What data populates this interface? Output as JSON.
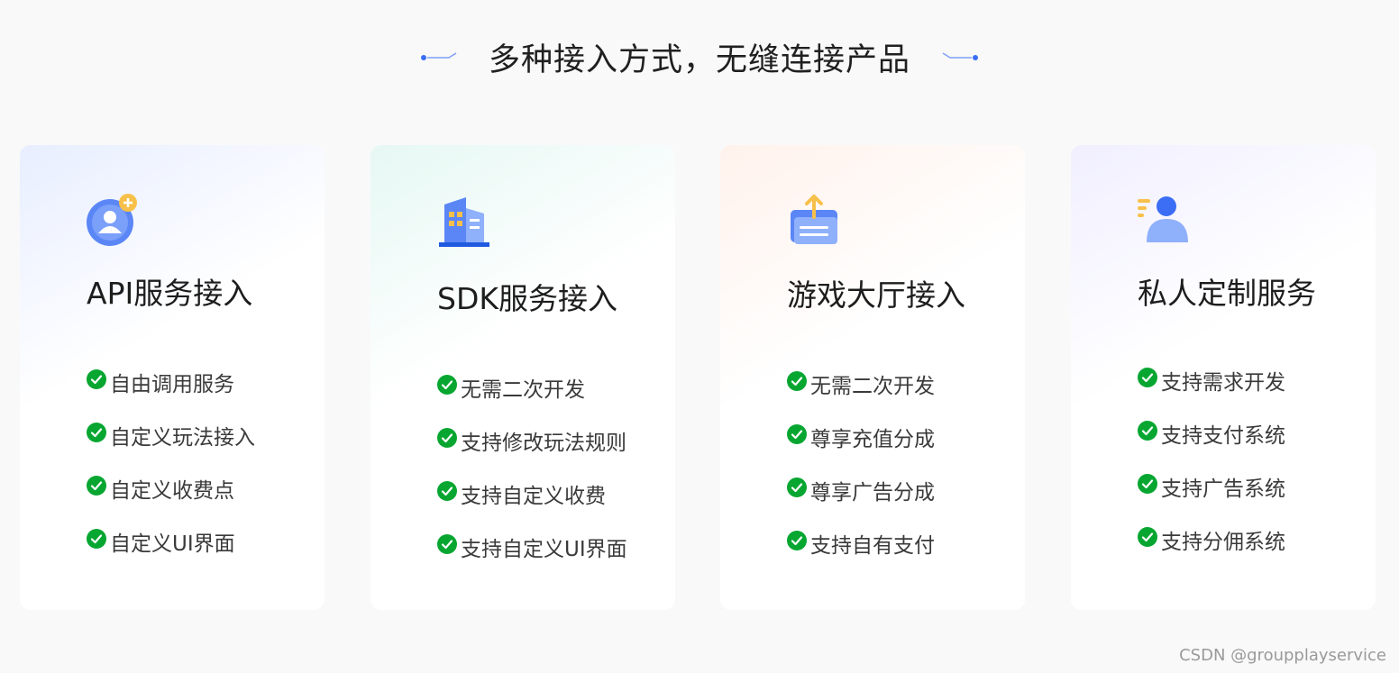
{
  "heading": {
    "title": "多种接入方式，无缝连接产品"
  },
  "colors": {
    "accent": "#3b6ef5",
    "check": "#07a631",
    "gold": "#f7c04a"
  },
  "cards": [
    {
      "icon": "user-add-icon",
      "title": "API服务接入",
      "features": [
        "自由调用服务",
        "自定义玩法接入",
        "自定义收费点",
        "自定义UI界面"
      ]
    },
    {
      "icon": "building-icon",
      "title": "SDK服务接入",
      "features": [
        "无需二次开发",
        "支持修改玩法规则",
        "支持自定义收费",
        "支持自定义UI界面"
      ]
    },
    {
      "icon": "upload-inbox-icon",
      "title": "游戏大厅接入",
      "features": [
        "无需二次开发",
        "尊享充值分成",
        "尊享广告分成",
        "支持自有支付"
      ]
    },
    {
      "icon": "user-list-icon",
      "title": "私人定制服务",
      "features": [
        "支持需求开发",
        "支持支付系统",
        "支持广告系统",
        "支持分佣系统"
      ]
    }
  ],
  "watermark": "CSDN @groupplayservice"
}
